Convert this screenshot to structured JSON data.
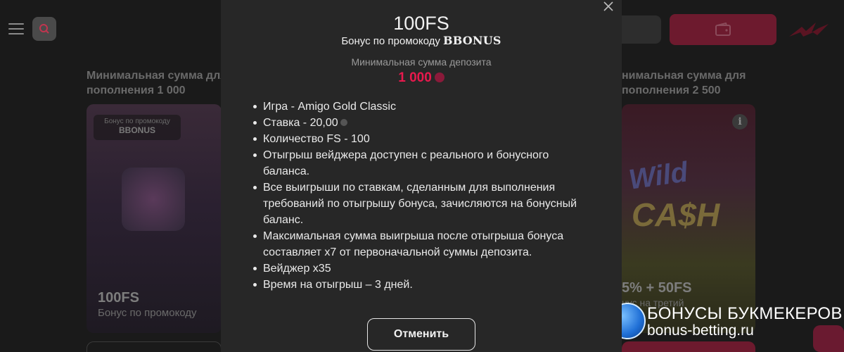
{
  "background": {
    "left_section_title": "Минимальная сумма для пополнения 1 000",
    "right_section_title": "нимальная сумма для пополнения 2 500",
    "left_card": {
      "badge_line1": "Бонус по промокоду",
      "badge_line2": "BBONUS",
      "big": "100FS",
      "sub": "Бонус по промокоду"
    },
    "right_card": {
      "art_word1": "Wild",
      "art_word2": "CA$H",
      "big": "5% + 50FS",
      "sub": "нус на третий"
    },
    "info_icon_label": "i",
    "watermark": {
      "line1": "БОНУСЫ БУКМЕКЕРОВ",
      "line2": "bonus-betting.ru"
    }
  },
  "modal": {
    "title": "100FS",
    "promo_label": "Бонус по промокоду",
    "promo_code": "BBONUS",
    "min_deposit_label": "Минимальная сумма депозита",
    "min_deposit_value": "1 000",
    "conditions": [
      "Игра - Amigo Gold Classic",
      "Ставка - 20,00",
      "Количество FS - 100",
      "Отыгрыш вейджера доступен с реального и бонусного баланса.",
      "Все выигрыши по ставкам, сделанным для выполнения требований по отыгрышу бонуса, зачисляются на бонусный баланс.",
      "Максимальная сумма выигрыша после отыгрыша бонуса составляет x7 от первоначальной суммы депозита.",
      "Вейджер x35",
      "Время на отыгрыш – 3 дней."
    ],
    "cancel_label": "Отменить"
  },
  "colors": {
    "accent": "#e8194d",
    "modal_bg": "#272727",
    "page_bg": "#1a1a1a"
  }
}
